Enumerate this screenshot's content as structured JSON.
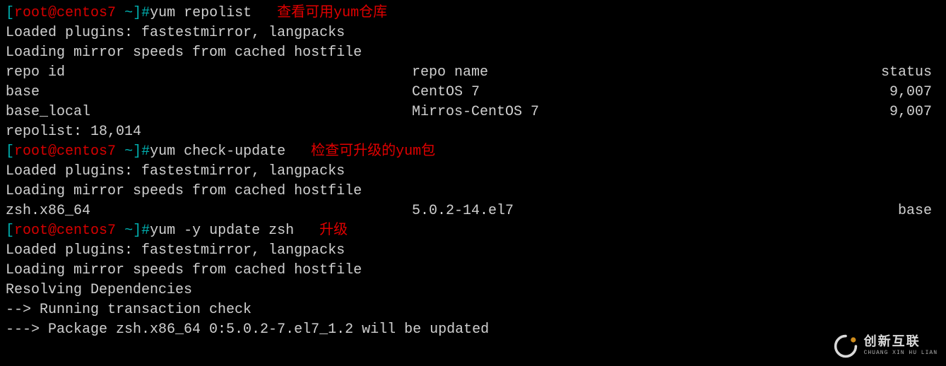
{
  "prompt": {
    "lbracket": "[",
    "user": "root",
    "at": "@",
    "host": "centos7",
    "space": " ",
    "tilde": "~",
    "rbracket": "]#"
  },
  "lines": {
    "l1_cmd": "yum repolist   ",
    "l1_note": "查看可用yum仓库",
    "l2": "Loaded plugins: fastestmirror, langpacks",
    "l3": "Loading mirror speeds from cached hostfile",
    "l4_c1": "repo id",
    "l4_c2": "repo name",
    "l4_c3": "status",
    "l5_c1": "base",
    "l5_c2": "CentOS 7",
    "l5_c3": "9,007",
    "l6_c1": "base_local",
    "l6_c2": "Mirros-CentOS 7",
    "l6_c3": "9,007",
    "l7": "repolist: 18,014",
    "l8_cmd": "yum check-update   ",
    "l8_note": "检查可升级的yum包",
    "l9": "Loaded plugins: fastestmirror, langpacks",
    "l10": "Loading mirror speeds from cached hostfile",
    "l11": "",
    "l12_c1": "zsh.x86_64",
    "l12_c2": "5.0.2-14.el7",
    "l12_c3": "base",
    "l13_cmd": "yum -y update zsh   ",
    "l13_note": "升级",
    "l14": "Loaded plugins: fastestmirror, langpacks",
    "l15": "Loading mirror speeds from cached hostfile",
    "l16": "Resolving Dependencies",
    "l17": "--> Running transaction check",
    "l18": "---> Package zsh.x86_64 0:5.0.2-7.el7_1.2 will be updated"
  },
  "watermark": {
    "cn": "创新互联",
    "en": "CHUANG XIN HU LIAN"
  }
}
